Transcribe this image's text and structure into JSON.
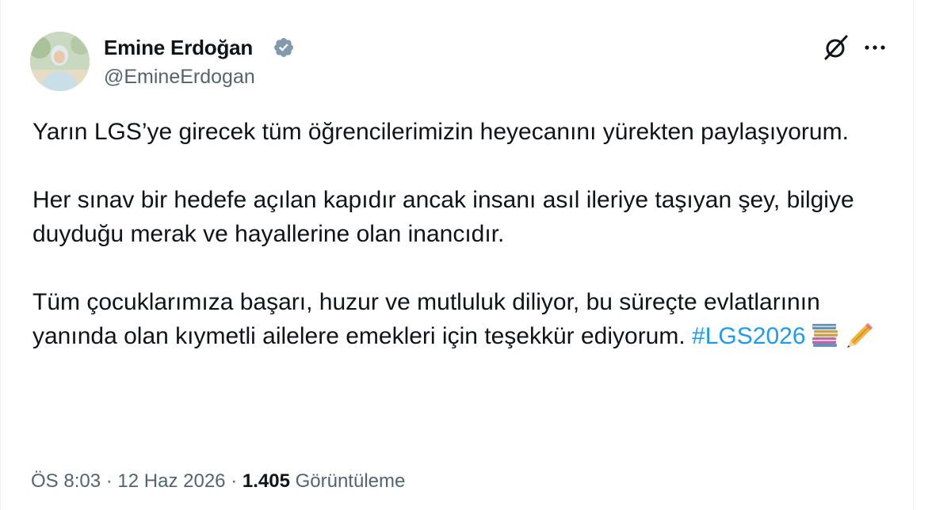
{
  "author": {
    "name": "Emine Erdoğan",
    "handle": "@EmineErdogan",
    "verified_color": "#829aab"
  },
  "header_actions": {
    "grok_icon": "grok-icon",
    "more_icon": "more-icon",
    "more_label": "···"
  },
  "tweet": {
    "paragraph1": "Yarın LGS’ye girecek tüm öğrencilerimizin heyecanını yürekten paylaşıyorum.",
    "paragraph2": "Her sınav bir hedefe açılan kapıdır ancak insanı asıl ileriye taşıyan şey, bilgiye duyduğu merak ve hayallerine olan inancıdır.",
    "paragraph3_text": "Tüm çocuklarımıza başarı, huzur ve mutluluk diliyor, bu süreçte evlatlarının yanında olan kıymetli ailelere emekleri için teşekkür ediyorum.",
    "hashtag": "#LGS2026",
    "hashtag_color": "#1d9bf0",
    "emojis": [
      "books-emoji",
      "pencil-emoji"
    ]
  },
  "meta": {
    "time": "ÖS 8:03",
    "separator": "·",
    "date": "12 Haz 2026",
    "views_count": "1.405",
    "views_label": "Görüntüleme"
  }
}
